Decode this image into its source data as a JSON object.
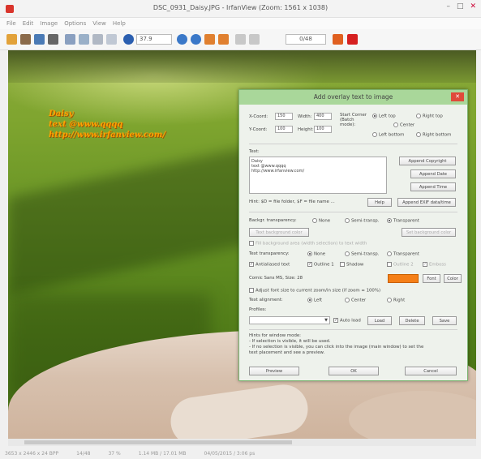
{
  "window": {
    "title": "DSC_0931_Daisy.JPG - IrfanView (Zoom: 1561 x 1038)",
    "controls": [
      "–",
      "□",
      "✕"
    ]
  },
  "menu": [
    "File",
    "Edit",
    "Image",
    "Options",
    "View",
    "Help"
  ],
  "toolbar": {
    "zoom_value": "37.9",
    "page_value": "0/48"
  },
  "image": {
    "overlay_lines": [
      "Daisy",
      "text @www.qqqq",
      "http://www.irfanview.com/"
    ]
  },
  "status": {
    "items": [
      "3653 x 2446 x 24 BPP",
      "14/48",
      "37 %",
      "1.14 MB / 17.01 MB",
      "04/05/2015 / 3:06 ps"
    ]
  },
  "dialog": {
    "title": "Add overlay text to image",
    "close": "✕",
    "xcoord_label": "X-Coord:",
    "xcoord_value": "150",
    "ycoord_label": "Y-Coord:",
    "ycoord_value": "100",
    "width_label": "Width:",
    "width_value": "400",
    "height_label": "Height:",
    "height_value": "100",
    "start_corner_label": "Start Corner (Batch mode):",
    "corner_left_top": "Left top",
    "corner_right_top": "Right top",
    "corner_center": "Center",
    "corner_left_bottom": "Left bottom",
    "corner_right_bottom": "Right bottom",
    "text_label": "Text:",
    "text_value": "Daisy\ntext @www.qqqq\nhttp://www.irfanview.com/",
    "append_copyright": "Append Copyright",
    "append_date": "Append Date",
    "append_time": "Append Time",
    "hint": "Hint: $D = file folder, $F = file name ...",
    "help": "Help",
    "append_exif": "Append EXIF data/time",
    "bkgd_transparency_label": "Backgr. transparency:",
    "opt_none": "None",
    "opt_semi": "Semi-transp.",
    "opt_transparent": "Transparent",
    "text_background_color": "Text background color",
    "set_background_color": "Set background color",
    "bkgd_note": "Fill background area (width selection) to text width",
    "text_transparency_label": "Text transparency:",
    "antialiased_text": "Antialiased text",
    "outline_1": "Outline 1",
    "shadow": "Shadow",
    "outline_2": "Outline 2",
    "emboss": "Emboss",
    "font_desc": "Comic Sans MS, Size: 28",
    "font_button": "Font",
    "color_button": "Color",
    "adjust_font": "Adjust font size to current zoom/in size (if zoom = 100%)",
    "text_alignment_label": "Text alignment:",
    "align_left": "Left",
    "align_center": "Center",
    "align_right": "Right",
    "profiles_label": "Profiles:",
    "auto_load": "Auto load",
    "load": "Load",
    "delete": "Delete",
    "save": "Save",
    "help_lines": [
      "Hints for window mode:",
      "- If selection is visible, it will be used.",
      "- If no selection is visible, you can click into the image (main window) to set the",
      "  text placement and see a preview."
    ],
    "preview": "Preview",
    "ok": "OK",
    "cancel": "Cancel"
  }
}
